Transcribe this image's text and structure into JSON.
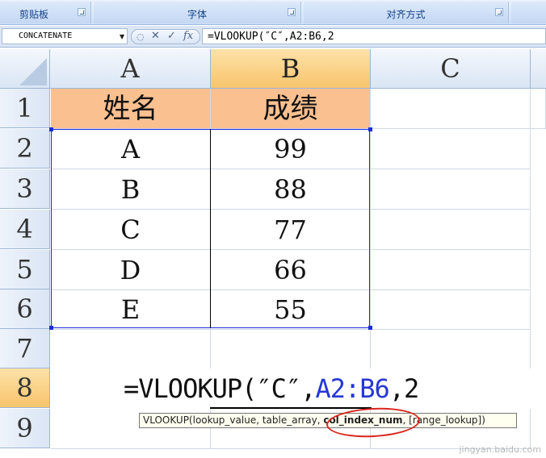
{
  "ribbon": {
    "groups": [
      {
        "label": "剪贴板"
      },
      {
        "label": "字体"
      },
      {
        "label": "对齐方式"
      }
    ]
  },
  "formula_bar": {
    "name_box": "CONCATENATE",
    "cancel_symbol": "✕",
    "enter_symbol": "✓",
    "fx_symbol": "fx",
    "formula_text": "=VLOOKUP(″C″,A2:B6,2"
  },
  "columns": [
    "A",
    "B",
    "C"
  ],
  "rows": [
    "1",
    "2",
    "3",
    "4",
    "5",
    "6",
    "7",
    "8",
    "9"
  ],
  "table": {
    "header": {
      "name": "姓名",
      "score": "成绩"
    },
    "data": [
      {
        "name": "A",
        "score": "99"
      },
      {
        "name": "B",
        "score": "88"
      },
      {
        "name": "C",
        "score": "77"
      },
      {
        "name": "D",
        "score": "66"
      },
      {
        "name": "E",
        "score": "55"
      }
    ]
  },
  "editing_cell": {
    "part1": "=VLOOKUP(″C″,",
    "ref": "A2:B6",
    "part2": ",2"
  },
  "tooltip": {
    "prefix": "VLOOKUP(lookup_value, table_array, ",
    "active_arg": "col_index_num",
    "suffix": ", [range_lookup])"
  },
  "watermark": "jingyan.baidu.com",
  "colors": {
    "header_fill": "#fac090",
    "selection_border": "#1c2ed8",
    "reference_text": "#2637d6",
    "annotation_circle": "#d9241c"
  }
}
